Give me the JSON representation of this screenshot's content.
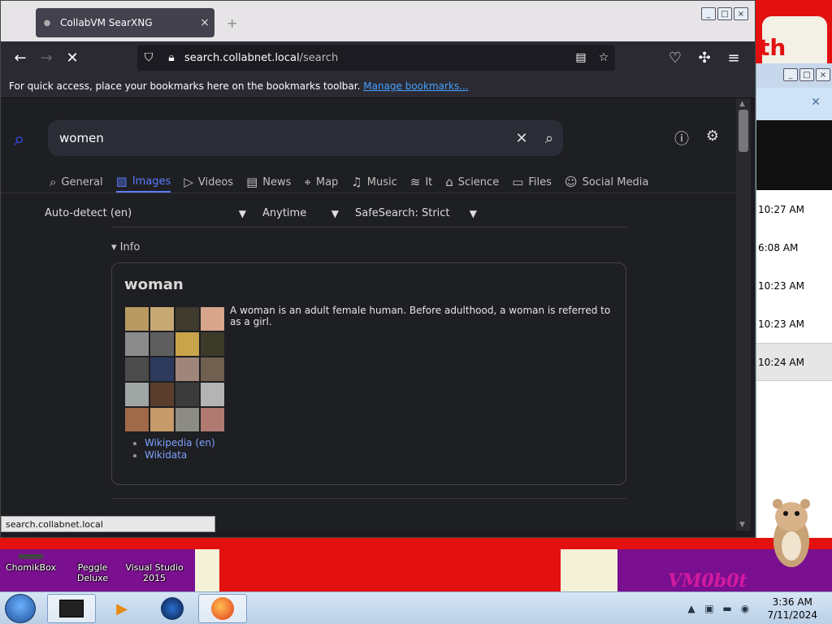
{
  "browser": {
    "tab_title": "CollabVM SearXNG",
    "tab_close": "×",
    "new_tab": "+",
    "url_host": "search.collabnet.local",
    "url_path": "/search",
    "bookmarks_text": "For quick access, place your bookmarks here on the bookmarks toolbar.",
    "bookmarks_link": "Manage bookmarks...",
    "status_url": "search.collabnet.local"
  },
  "search": {
    "query": "women",
    "categories": [
      {
        "label": "General",
        "icon": "search-icon",
        "glyph": "⌕"
      },
      {
        "label": "Images",
        "icon": "image-icon",
        "glyph": "▨"
      },
      {
        "label": "Videos",
        "icon": "play-icon",
        "glyph": "▷"
      },
      {
        "label": "News",
        "icon": "newspaper-icon",
        "glyph": "▤"
      },
      {
        "label": "Map",
        "icon": "map-pin-icon",
        "glyph": "⌖"
      },
      {
        "label": "Music",
        "icon": "music-note-icon",
        "glyph": "♫"
      },
      {
        "label": "It",
        "icon": "layers-icon",
        "glyph": "≋"
      },
      {
        "label": "Science",
        "icon": "graduation-cap-icon",
        "glyph": "⌂"
      },
      {
        "label": "Files",
        "icon": "archive-icon",
        "glyph": "▭"
      },
      {
        "label": "Social Media",
        "icon": "people-icon",
        "glyph": "☺"
      }
    ],
    "active_category": "Images",
    "filters": {
      "language": "Auto-detect (en)",
      "time": "Anytime",
      "safesearch": "SafeSearch: Strict"
    },
    "info_heading": "Info",
    "infobox": {
      "title": "woman",
      "description": "A woman is an adult female human. Before adulthood, a woman is referred to as a girl.",
      "links": [
        "Wikipedia (en)",
        "Wikidata"
      ]
    }
  },
  "background_window": {
    "times": [
      "10:27 AM",
      "6:08 AM",
      "10:23 AM",
      "10:23 AM",
      "10:24 AM"
    ]
  },
  "desktop": {
    "icons": [
      "ChomikBox",
      "Peggle Deluxe",
      "Visual Studio 2015"
    ],
    "wall_text": "th",
    "wall_tag": "VM0b0t"
  },
  "taskbar": {
    "time": "3:36 AM",
    "date": "7/11/2024"
  },
  "colors": {
    "accent": "#5c7bff",
    "link": "#45a1ff",
    "page_bg": "#1e1f22"
  }
}
